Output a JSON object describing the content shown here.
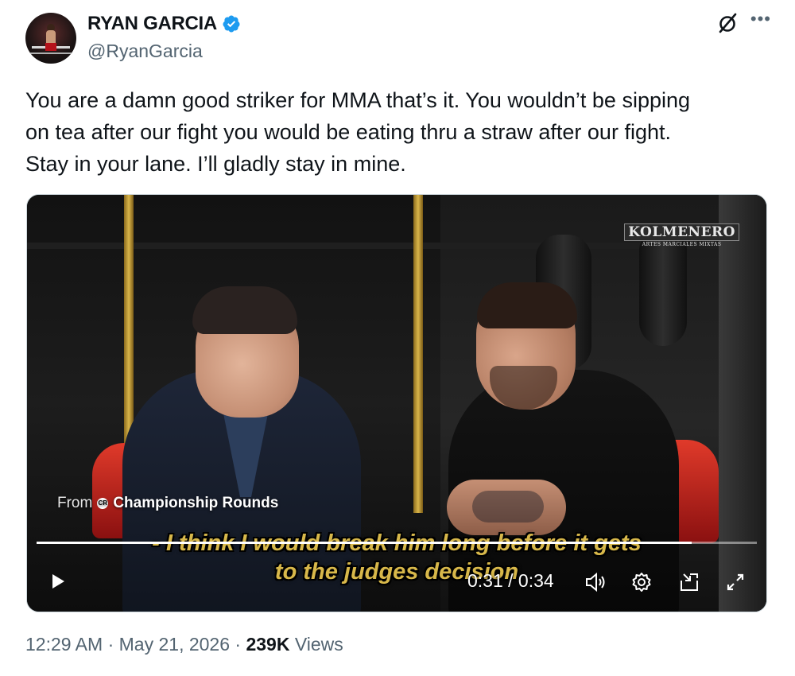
{
  "author": {
    "display_name": "RYAN GARCIA",
    "handle": "@RyanGarcia",
    "verified": true
  },
  "tweet": {
    "text_lines": [
      "You are a damn good striker for MMA that’s it. You wouldn’t be sipping",
      "on tea after our fight you would be eating thru a straw after our fight.",
      "Stay in your lane. I’ll gladly stay in mine."
    ]
  },
  "video": {
    "watermark_title": "KOLMENERO",
    "watermark_subtitle": "ARTES MARCIALES MIXTAS",
    "from_label": "From",
    "channel_name": "Championship Rounds",
    "subtitle_lines": [
      "- I think I would break him long before it gets",
      "to the judges decision"
    ],
    "current_time": "0:31",
    "duration": "0:34",
    "time_display": "0:31 / 0:34",
    "progress_fraction": 0.91
  },
  "meta": {
    "time": "12:29 AM",
    "date": "May 21, 2026",
    "views_count": "239K",
    "views_label": "Views"
  },
  "icons": {
    "verified": "verified-badge-icon",
    "grok": "grok-icon",
    "more": "more-icon",
    "play": "play-icon",
    "volume": "volume-icon",
    "settings": "settings-icon",
    "pip": "picture-in-picture-icon",
    "fullscreen": "fullscreen-icon"
  },
  "colors": {
    "accent_blue": "#1d9bf0",
    "text_primary": "#0f1419",
    "text_secondary": "#536471",
    "subtitle_gold": "#d8b84a"
  }
}
